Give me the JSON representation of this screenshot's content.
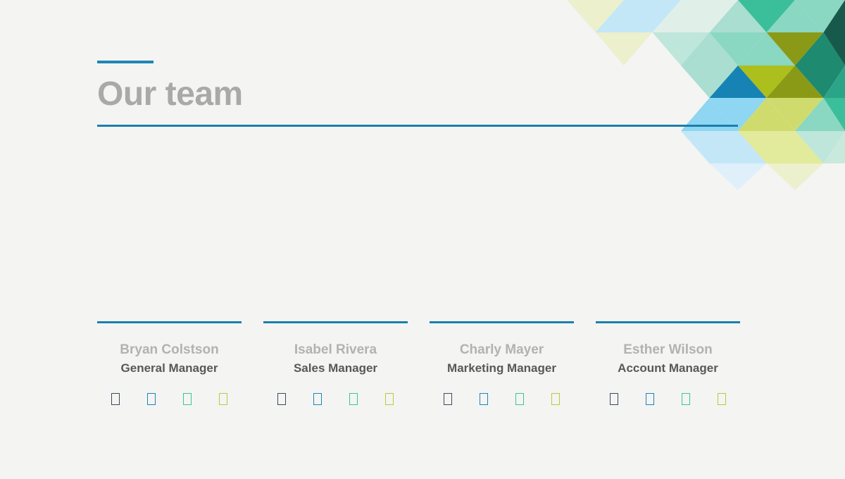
{
  "slide": {
    "background_color": "#f4f4f3",
    "accent_color": "#1b7fae"
  },
  "header": {
    "title": "Our team",
    "title_color": "#a9a9a9",
    "accent_bar_color": "#1f86b4",
    "rule_color": "#1b7fae"
  },
  "team": {
    "members": [
      {
        "name": "Bryan Colstson",
        "role": "General Manager"
      },
      {
        "name": "Isabel Rivera",
        "role": "Sales Manager"
      },
      {
        "name": "Charly Mayer",
        "role": "Marketing Manager"
      },
      {
        "name": "Esther Wilson",
        "role": "Account Manager"
      }
    ],
    "social_icons": [
      {
        "name": "social-icon-1",
        "color": "#3d4a5c"
      },
      {
        "name": "social-icon-2",
        "color": "#1b86b8"
      },
      {
        "name": "social-icon-3",
        "color": "#36c79a"
      },
      {
        "name": "social-icon-4",
        "color": "#bdc93a"
      }
    ],
    "name_color": "#b2b2b2",
    "role_color": "#585858",
    "rule_color": "#1b7fae"
  },
  "decoration": {
    "name": "triangle-mosaic",
    "palette": {
      "pale_yellow": "#edf0cd",
      "pale_yellow_2": "#e7ecc0",
      "light_blue": "#c3e7f7",
      "sky_blue": "#8ed6f2",
      "mint_pale": "#e0f0e9",
      "mint": "#bfe6da",
      "mint_2": "#a9ded0",
      "teal_soft": "#8ad7c2",
      "teal": "#3bbf9a",
      "teal_dark": "#2aa587",
      "green_dark": "#1e8a6f",
      "green_deep": "#17594a",
      "blue_strong": "#1683b4",
      "olive": "#8a9a17",
      "olive_bright": "#acbf1c",
      "yellow_green": "#cfdc6d",
      "yellow_green_pale": "#e2ea9b"
    }
  }
}
